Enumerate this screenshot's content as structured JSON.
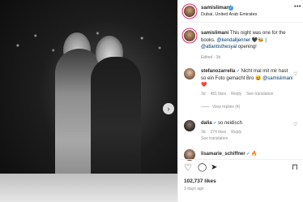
{
  "post": {
    "username": "samislimani",
    "location": "Dubai, United Arab Emirates",
    "more_label": "•••",
    "caption": {
      "username": "samislimani",
      "text_before": " This night was one for the books. ",
      "mention1": "@kendalljenner",
      "text_middle": " 🖤🐝 | ",
      "mention2": "@atlantisthesyal",
      "text_after": " opening!",
      "edited": "Edited · 3d"
    },
    "comments": [
      {
        "username": "stefanozarrella",
        "verified": true,
        "text": " Nicht mal mit mir hast so ein Foto gemacht Bro 😆 ",
        "mention": "@samislimani",
        "emoji": "❤️",
        "meta": [
          "3d",
          "481 likes",
          "Reply",
          "See translation"
        ],
        "view_replies": "View replies (4)"
      },
      {
        "username": "dalia",
        "verified": true,
        "text": " so neidisch",
        "meta": [
          "3d",
          "274 likes",
          "Reply"
        ],
        "see_translation": "See translation"
      },
      {
        "username": "lisamarie_schiffner",
        "verified": true,
        "text": " 🔥"
      }
    ],
    "likes": "102,737 likes",
    "time": "3 days ago",
    "next_icon": "›",
    "icons": {
      "like": "♡",
      "comment": "◯",
      "share": "➤",
      "save": "⊓"
    }
  }
}
